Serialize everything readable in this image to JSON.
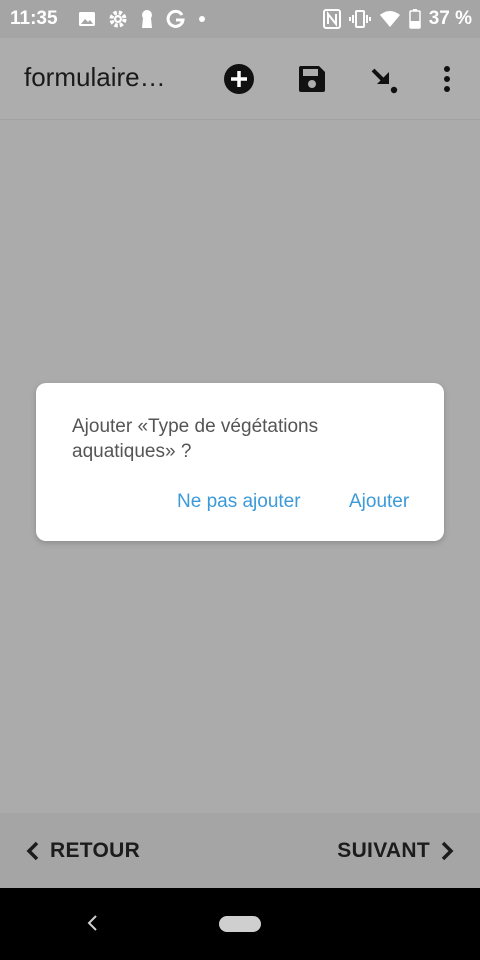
{
  "status_bar": {
    "time": "11:35",
    "battery_percent": "37 %",
    "left_icons": [
      "image-icon",
      "gear-icon",
      "keyhole-icon",
      "google-g-icon",
      "dot-icon"
    ],
    "right_icons": [
      "nfc-icon",
      "vibrate-icon",
      "wifi-icon",
      "battery-icon"
    ]
  },
  "app_bar": {
    "title": "formulaire…",
    "actions": [
      "add-circle-icon",
      "save-icon",
      "arrow-down-right-icon",
      "more-vert-icon"
    ]
  },
  "dialog": {
    "message": "Ajouter «Type de végétations aquatiques» ?",
    "cancel_label": "Ne pas ajouter",
    "confirm_label": "Ajouter",
    "accent_color": "#3b9ad8"
  },
  "bottom_bar": {
    "back_label": "RETOUR",
    "next_label": "SUIVANT"
  },
  "colors": {
    "scrim": "#ababab",
    "dialog_bg": "#ffffff"
  }
}
